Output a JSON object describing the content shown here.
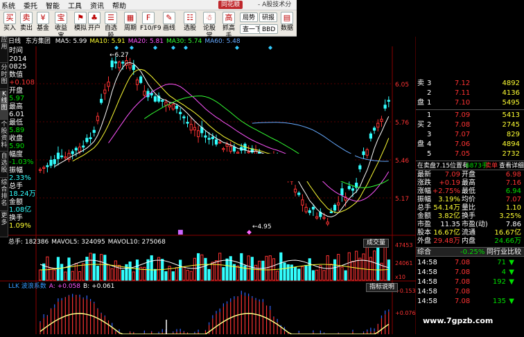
{
  "menu": {
    "items": [
      "系统",
      "委托",
      "智能",
      "工具",
      "资讯",
      "帮助"
    ],
    "brand": "同花顺",
    "title": "- A股技术分析"
  },
  "toolbar": {
    "buttons": [
      {
        "label": "买入",
        "glyph": "买"
      },
      {
        "label": "卖出",
        "glyph": "卖"
      },
      {
        "label": "基金",
        "glyph": "¥"
      },
      {
        "label": "收益宝",
        "glyph": "宝"
      },
      {
        "label": "模拟",
        "glyph": "⚑"
      },
      {
        "label": "开户",
        "glyph": "♣"
      },
      {
        "label": "自选股",
        "glyph": "☰"
      },
      {
        "label": "周期",
        "glyph": "▦"
      },
      {
        "label": "F10/F9",
        "glyph": "F"
      },
      {
        "label": "画线",
        "glyph": "✎"
      },
      {
        "label": "选股",
        "glyph": "☷"
      },
      {
        "label": "论股堂",
        "glyph": "☃"
      },
      {
        "label": "抓高手",
        "glyph": "高"
      },
      {
        "label": "数据",
        "glyph": "▤"
      }
    ],
    "small": [
      "局势",
      "研报",
      "查一下",
      "BBD"
    ]
  },
  "left_tabs": [
    "应用",
    "分时图",
    "K线图",
    "个股资料",
    "自选股",
    "综合排名",
    "更多"
  ],
  "stock": {
    "period": "日线",
    "name": "东方集团"
  },
  "ma": [
    {
      "label": "MA5: 5.99",
      "color": "#ffffff"
    },
    {
      "label": "MA10: 5.91",
      "color": "#ffff33"
    },
    {
      "label": "MA20: 5.81",
      "color": "#ff55ff"
    },
    {
      "label": "MA30: 5.74",
      "color": "#33ff33"
    },
    {
      "label": "MA60: 5.48",
      "color": "#66aaff"
    }
  ],
  "info": [
    {
      "t": "时间",
      "c": "white"
    },
    {
      "t": "2014",
      "c": "white"
    },
    {
      "t": "0825",
      "c": "white"
    },
    {
      "t": "数值",
      "c": "white"
    },
    {
      "t": "+0.108",
      "c": "red"
    },
    {
      "t": "开盘",
      "c": "white"
    },
    {
      "t": "5.97",
      "c": "green"
    },
    {
      "t": "最高",
      "c": "white"
    },
    {
      "t": "6.01",
      "c": "white"
    },
    {
      "t": "最低",
      "c": "white"
    },
    {
      "t": "5.89",
      "c": "green"
    },
    {
      "t": "收盘",
      "c": "white"
    },
    {
      "t": "5.90",
      "c": "green"
    },
    {
      "t": "幅度",
      "c": "white"
    },
    {
      "t": "-1.03%",
      "c": "green"
    },
    {
      "t": "振幅",
      "c": "white"
    },
    {
      "t": "2.33%",
      "c": "cyan"
    },
    {
      "t": "总手",
      "c": "white"
    },
    {
      "t": "18.24万",
      "c": "cyan"
    },
    {
      "t": "金额",
      "c": "white"
    },
    {
      "t": "1.08亿",
      "c": "cyan"
    },
    {
      "t": "换手",
      "c": "white"
    },
    {
      "t": "1.09%",
      "c": "yellow"
    }
  ],
  "price_axis": [
    "6.05",
    "5.76",
    "5.46",
    "5.17"
  ],
  "annotations": {
    "high": "6.27",
    "low": "4.95"
  },
  "volume": {
    "header": [
      {
        "t": "总手: 182386",
        "c": "#ffffff"
      },
      {
        "t": "MAVOL5: 324095",
        "c": "#ffffff"
      },
      {
        "t": "MAVOL10: 275068",
        "c": "#ffffff"
      }
    ],
    "button": "成交量",
    "axis": [
      "47453",
      "24061",
      "x10"
    ]
  },
  "llk": {
    "header": [
      {
        "t": "LLK 波浪系数",
        "c": "#3399ff"
      },
      {
        "t": "A: +0.058",
        "c": "#ff55ff"
      },
      {
        "t": "B: +0.061",
        "c": "#ffffff"
      }
    ],
    "button": "指标说明",
    "axis": [
      "+0.153",
      "+0.076"
    ]
  },
  "orderbook": {
    "asks": [
      {
        "label": "卖",
        "n": "3",
        "price": "7.12",
        "vol": "4892"
      },
      {
        "label": "",
        "n": "2",
        "price": "7.11",
        "vol": "4136"
      },
      {
        "label": "盘",
        "n": "1",
        "price": "7.10",
        "vol": "5495"
      }
    ],
    "bids": [
      {
        "label": "",
        "n": "1",
        "price": "7.09",
        "vol": "5413"
      },
      {
        "label": "买",
        "n": "2",
        "price": "7.08",
        "vol": "2745"
      },
      {
        "label": "",
        "n": "3",
        "price": "7.07",
        "vol": "829"
      },
      {
        "label": "盘",
        "n": "4",
        "price": "7.06",
        "vol": "4894"
      },
      {
        "label": "",
        "n": "5",
        "price": "7.05",
        "vol": "2732"
      }
    ]
  },
  "status": {
    "left": "在卖盘7.15位置有",
    "count": "6873手",
    "buy": "卖单",
    "link": "查看详细"
  },
  "quote": [
    {
      "l": "最新",
      "v": "7.09",
      "vc": "red",
      "l2": "开盘",
      "v2": "6.98",
      "v2c": "red"
    },
    {
      "l": "涨跌",
      "v": "+0.19",
      "vc": "red",
      "l2": "最高",
      "v2": "7.16",
      "v2c": "red"
    },
    {
      "l": "涨幅",
      "v": "+2.75%",
      "vc": "red",
      "l2": "最低",
      "v2": "6.94",
      "v2c": "green"
    },
    {
      "l": "振幅",
      "v": "3.19%",
      "vc": "yellow",
      "l2": "均价",
      "v2": "7.07",
      "v2c": "red"
    },
    {
      "l": "总手",
      "v": "54.14万",
      "vc": "yellow",
      "l2": "量比",
      "v2": "1.10",
      "v2c": "yellow"
    },
    {
      "l": "金额",
      "v": "3.82亿",
      "vc": "yellow",
      "l2": "换手",
      "v2": "3.25%",
      "v2c": "yellow"
    },
    {
      "l": "市盈",
      "v": "11.35",
      "vc": "white",
      "l2": "市盈(动)",
      "v2": "7.86",
      "v2c": "white"
    },
    {
      "l": "股本",
      "v": "16.67亿",
      "vc": "yellow",
      "l2": "流通",
      "v2": "16.67亿",
      "v2c": "yellow"
    },
    {
      "l": "外盘",
      "v": "29.48万",
      "vc": "red",
      "l2": "内盘",
      "v2": "24.66万",
      "v2c": "green"
    }
  ],
  "composite": {
    "label": "综合",
    "value": "-0.25%",
    "link": "同行业比较"
  },
  "ticks": [
    {
      "time": "14:58",
      "price": "7.08",
      "vol": "71",
      "dir": "▼"
    },
    {
      "time": "14:58",
      "price": "7.08",
      "vol": "4",
      "dir": "▼"
    },
    {
      "time": "14:58",
      "price": "7.08",
      "vol": "192",
      "dir": "▼"
    },
    {
      "time": "14:58",
      "price": "7.08",
      "vol": "",
      "dir": ""
    },
    {
      "time": "14:58",
      "price": "7.08",
      "vol": "135",
      "dir": "▼"
    }
  ],
  "watermark": "www.7gpzb.com",
  "colors": {
    "up": "#ff3333",
    "down": "#33ffff",
    "ma5": "#ffffff",
    "ma10": "#ffff33",
    "ma20": "#ff55ff",
    "ma30": "#33ff33",
    "ma60": "#66aaff"
  }
}
